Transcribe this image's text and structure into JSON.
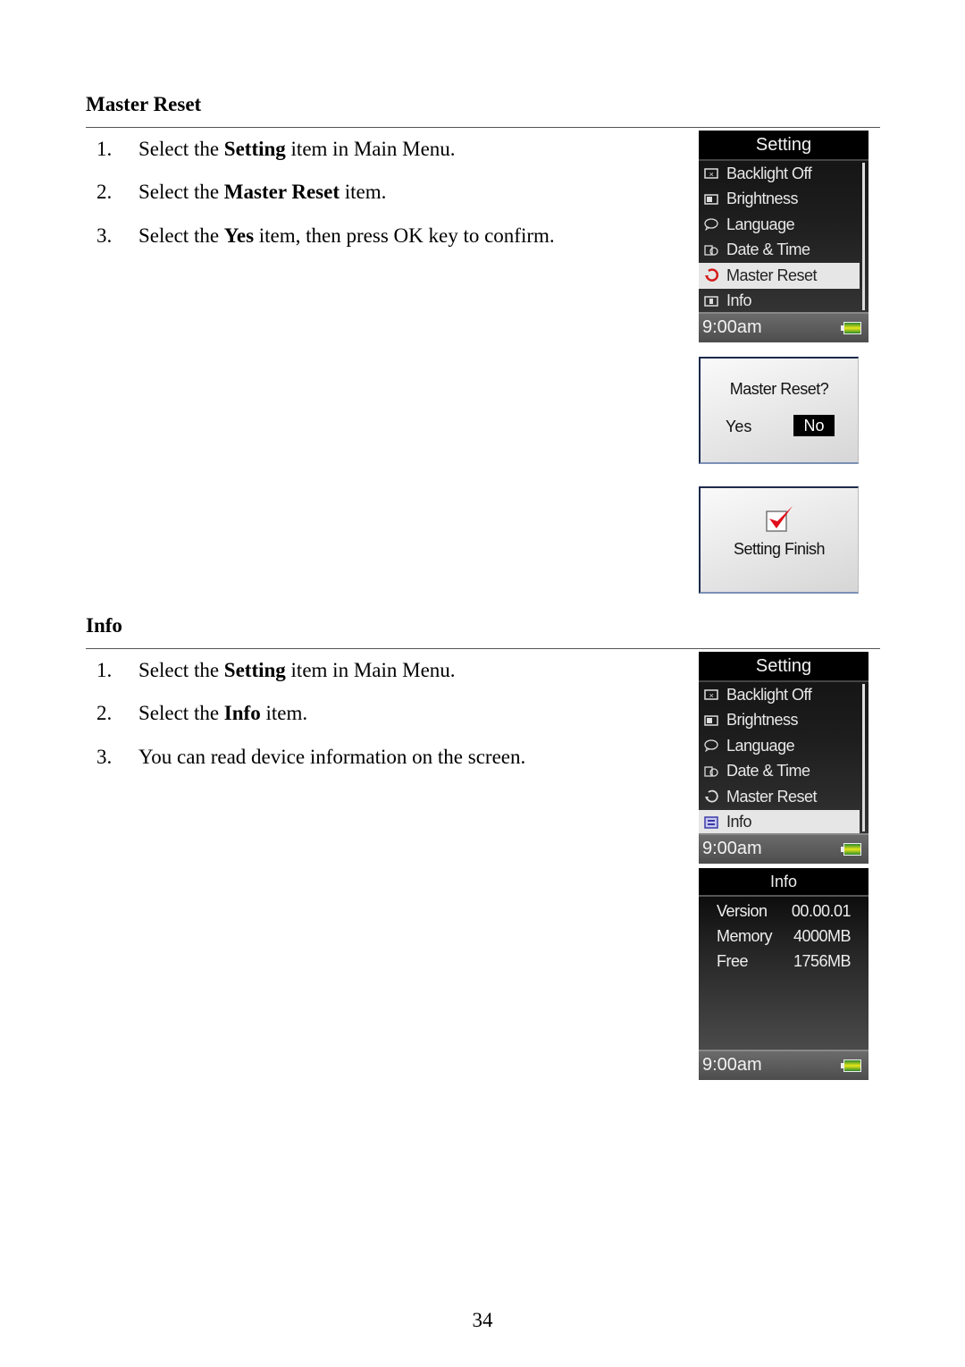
{
  "sections": [
    {
      "heading": "Master Reset",
      "steps": [
        {
          "num": "1.",
          "pre": "Select the ",
          "bold": "Setting",
          "post": " item in Main Menu."
        },
        {
          "num": "2.",
          "pre": "Select the ",
          "bold": "Master Reset",
          "post": " item."
        },
        {
          "num": "3.",
          "pre": "Select the ",
          "bold": "Yes",
          "post": " item, then press OK key to confirm."
        }
      ]
    },
    {
      "heading": "Info",
      "steps": [
        {
          "num": "1.",
          "pre": "Select the ",
          "bold": "Setting",
          "post": " item in Main Menu."
        },
        {
          "num": "2.",
          "pre": "Select the ",
          "bold": "Info",
          "post": " item."
        },
        {
          "num": "3.",
          "pre": "You can read device information on the screen.",
          "bold": "",
          "post": ""
        }
      ]
    }
  ],
  "setting_menu": {
    "title": "Setting",
    "items": [
      {
        "label": "Backlight Off",
        "icon": "backlight-icon"
      },
      {
        "label": "Brightness",
        "icon": "brightness-icon"
      },
      {
        "label": "Language",
        "icon": "language-icon"
      },
      {
        "label": "Date & Time",
        "icon": "date-time-icon"
      },
      {
        "label": "Master Reset",
        "icon": "master-reset-icon"
      },
      {
        "label": "Info",
        "icon": "info-icon"
      }
    ],
    "time": "9:00am"
  },
  "confirm_dialog": {
    "question": "Master Reset?",
    "yes": "Yes",
    "no": "No"
  },
  "finish_dialog": {
    "message": "Setting Finish"
  },
  "info_screen": {
    "title": "Info",
    "rows": [
      {
        "label": "Version",
        "value": "00.00.01"
      },
      {
        "label": "Memory",
        "value": "4000MB"
      },
      {
        "label": "Free",
        "value": "1756MB"
      }
    ],
    "time": "9:00am"
  },
  "page_number": "34"
}
